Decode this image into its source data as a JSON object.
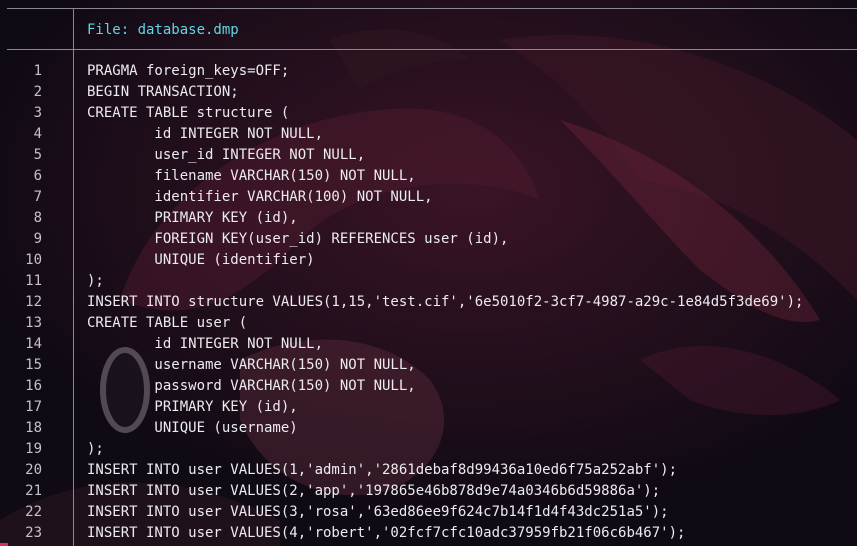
{
  "header": {
    "file_label": "File: database.dmp"
  },
  "colors": {
    "background": "#0f0a14",
    "accent": "#5fd7e2",
    "rule": "#8a8894",
    "text": "#ecebef",
    "line_number": "#c4c2c8"
  },
  "lines": [
    {
      "num": "1",
      "text": "PRAGMA foreign_keys=OFF;"
    },
    {
      "num": "2",
      "text": "BEGIN TRANSACTION;"
    },
    {
      "num": "3",
      "text": "CREATE TABLE structure ("
    },
    {
      "num": "4",
      "text": "        id INTEGER NOT NULL,"
    },
    {
      "num": "5",
      "text": "        user_id INTEGER NOT NULL,"
    },
    {
      "num": "6",
      "text": "        filename VARCHAR(150) NOT NULL,"
    },
    {
      "num": "7",
      "text": "        identifier VARCHAR(100) NOT NULL,"
    },
    {
      "num": "8",
      "text": "        PRIMARY KEY (id),"
    },
    {
      "num": "9",
      "text": "        FOREIGN KEY(user_id) REFERENCES user (id),"
    },
    {
      "num": "10",
      "text": "        UNIQUE (identifier)"
    },
    {
      "num": "11",
      "text": ");"
    },
    {
      "num": "12",
      "text": "INSERT INTO structure VALUES(1,15,'test.cif','6e5010f2-3cf7-4987-a29c-1e84d5f3de69');"
    },
    {
      "num": "13",
      "text": "CREATE TABLE user ("
    },
    {
      "num": "14",
      "text": "        id INTEGER NOT NULL,"
    },
    {
      "num": "15",
      "text": "        username VARCHAR(150) NOT NULL,"
    },
    {
      "num": "16",
      "text": "        password VARCHAR(150) NOT NULL,"
    },
    {
      "num": "17",
      "text": "        PRIMARY KEY (id),"
    },
    {
      "num": "18",
      "text": "        UNIQUE (username)"
    },
    {
      "num": "19",
      "text": ");"
    },
    {
      "num": "20",
      "text": "INSERT INTO user VALUES(1,'admin','2861debaf8d99436a10ed6f75a252abf');"
    },
    {
      "num": "21",
      "text": "INSERT INTO user VALUES(2,'app','197865e46b878d9e74a0346b6d59886a');"
    },
    {
      "num": "22",
      "text": "INSERT INTO user VALUES(3,'rosa','63ed86ee9f624c7b14f1d4f43dc251a5');"
    },
    {
      "num": "23",
      "text": "INSERT INTO user VALUES(4,'robert','02fcf7cfc10adc37959fb21f06c6b467');"
    }
  ]
}
